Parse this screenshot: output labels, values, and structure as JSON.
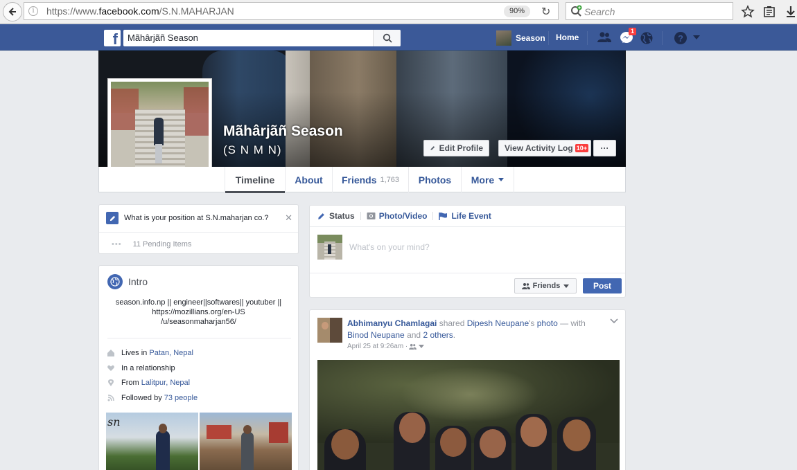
{
  "browser": {
    "url_prefix": "https://www.",
    "url_domain": "facebook.com",
    "url_path": "/S.N.MAHARJAN",
    "zoom": "90%",
    "search_placeholder": "Search"
  },
  "fb_header": {
    "logo": "f",
    "search_value": "Mãhârjãñ Season",
    "user_name": "Season",
    "home": "Home",
    "notifications_count": "1"
  },
  "profile": {
    "name": "Mãhârjãñ Season",
    "alt_name": "(S N M N)",
    "edit_profile": "Edit Profile",
    "activity_log": "View Activity Log",
    "activity_badge": "10+",
    "more_dots": "···"
  },
  "tabs": {
    "timeline": "Timeline",
    "about": "About",
    "friends": "Friends",
    "friends_count": "1,763",
    "photos": "Photos",
    "more": "More"
  },
  "pending": {
    "question": "What is your position at S.N.maharjan co.?",
    "dots": "•••",
    "items": "11 Pending Items"
  },
  "intro": {
    "title": "Intro",
    "bio_line1": "season.info.np || engineer||softwares|| youtuber ||",
    "bio_line2": "https://mozillians.org/en-US",
    "bio_line3": "/u/seasonmaharjan56/",
    "lives_label": "Lives in",
    "lives_value": "Patan, Nepal",
    "relationship": "In a relationship",
    "from_label": "From",
    "from_value": "Lalitpur, Nepal",
    "followed_label": "Followed by",
    "followed_value": "73 people",
    "thumb_caption": "sn"
  },
  "composer": {
    "status": "Status",
    "photo_video": "Photo/Video",
    "life_event": "Life Event",
    "placeholder": "What's on your mind?",
    "audience": "Friends",
    "post": "Post"
  },
  "feed_post": {
    "actor": "Abhimanyu Chamlagai",
    "verb": " shared ",
    "owner": "Dipesh Neupane",
    "owner_suffix": "'s ",
    "object": "photo",
    "with_text": " — with ",
    "tagged1": "Binod Neupane",
    "and_text": " and ",
    "tagged2": "2 others",
    "end": ".",
    "time": "April 25 at 9:26am · "
  },
  "colors": {
    "fb_blue": "#3b5998",
    "link": "#365899",
    "button_blue": "#4267b2",
    "badge_red": "#fa3e3e",
    "page_bg": "#e9ebee"
  }
}
